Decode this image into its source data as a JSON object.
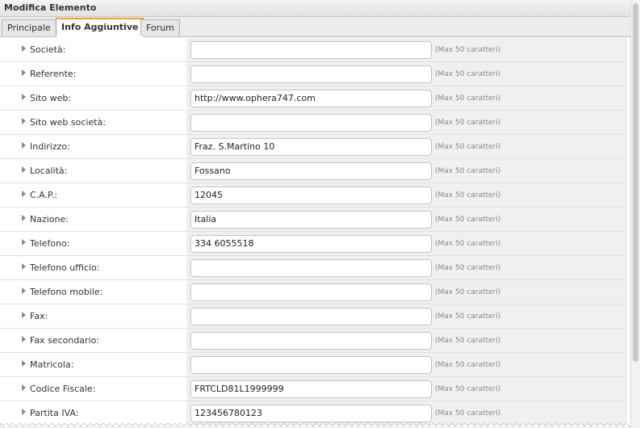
{
  "window": {
    "title": "Modifica Elemento"
  },
  "tabs": [
    {
      "label": "Principale",
      "active": false
    },
    {
      "label": "Info Aggiuntive",
      "active": true
    },
    {
      "label": "Forum",
      "active": false
    }
  ],
  "hint_text": "(Max 50 caratteri)",
  "fields": [
    {
      "label": "Società:",
      "value": ""
    },
    {
      "label": "Referente:",
      "value": ""
    },
    {
      "label": "Sito web:",
      "value": "http://www.ophera747.com"
    },
    {
      "label": "Sito web società:",
      "value": ""
    },
    {
      "label": "Indirizzo:",
      "value": "Fraz. S.Martino 10"
    },
    {
      "label": "Località:",
      "value": "Fossano"
    },
    {
      "label": "C.A.P.:",
      "value": "12045"
    },
    {
      "label": "Nazione:",
      "value": "Italia"
    },
    {
      "label": "Telefono:",
      "value": "334 6055518"
    },
    {
      "label": "Telefono ufficio:",
      "value": ""
    },
    {
      "label": "Telefono mobile:",
      "value": ""
    },
    {
      "label": "Fax:",
      "value": ""
    },
    {
      "label": "Fax secondario:",
      "value": ""
    },
    {
      "label": "Matricola:",
      "value": ""
    },
    {
      "label": "Codice Fiscale:",
      "value": "FRTCLD81L1999999"
    },
    {
      "label": "Partita IVA:",
      "value": "123456780123"
    }
  ],
  "icons": {
    "row_expander": "disclosure-triangle-icon"
  }
}
